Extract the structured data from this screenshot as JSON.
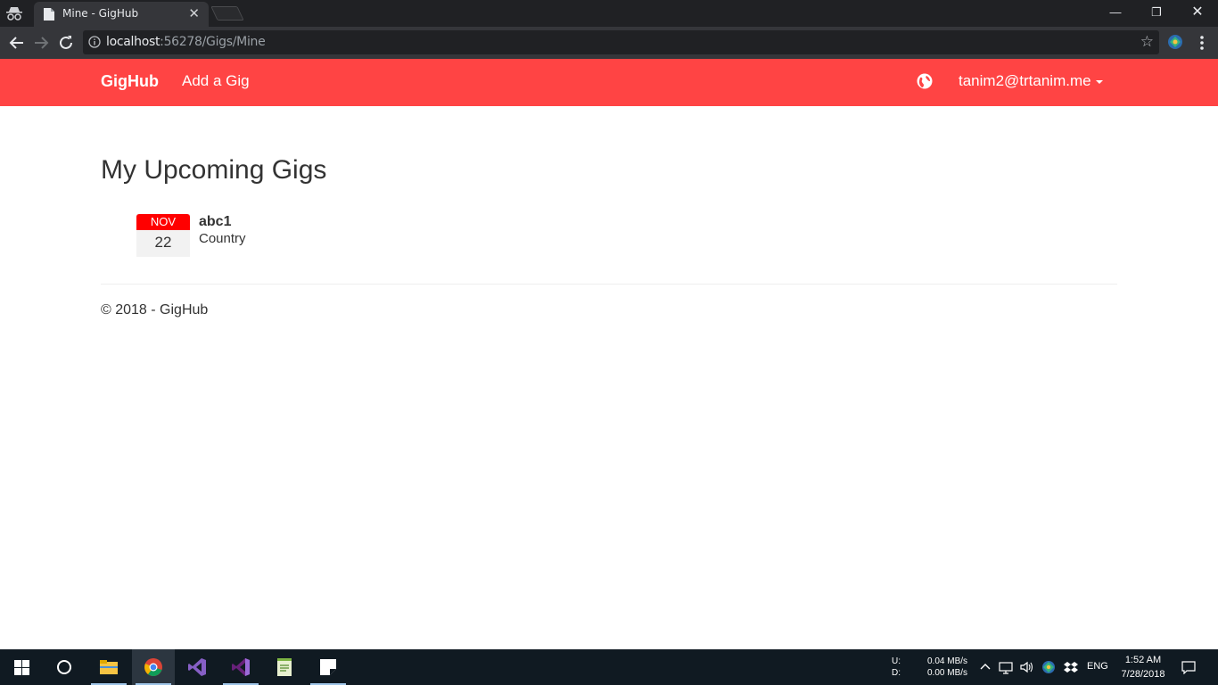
{
  "browser": {
    "tab_title": "Mine - GigHub",
    "tab_close": "✕",
    "url_host": "localhost",
    "url_path": ":56278/Gigs/Mine",
    "bookmark_star": "☆",
    "window_min": "—",
    "window_max": "❐",
    "window_close": "✕"
  },
  "navbar": {
    "brand": "GigHub",
    "add_gig": "Add a Gig",
    "user": "tanim2@trtanim.me"
  },
  "main": {
    "title": "My Upcoming Gigs",
    "gigs": [
      {
        "month": "NOV",
        "day": "22",
        "artist": "abc1",
        "genre": "Country"
      }
    ]
  },
  "footer": {
    "text": "© 2018 - GigHub"
  },
  "taskbar": {
    "upload_label": "U:",
    "download_label": "D:",
    "upload_speed": "0.04 MB/s",
    "download_speed": "0.00 MB/s",
    "language": "ENG",
    "time": "1:52 AM",
    "date": "7/28/2018"
  },
  "colors": {
    "navbar": "#ff4444",
    "date_badge": "#ff0000"
  }
}
